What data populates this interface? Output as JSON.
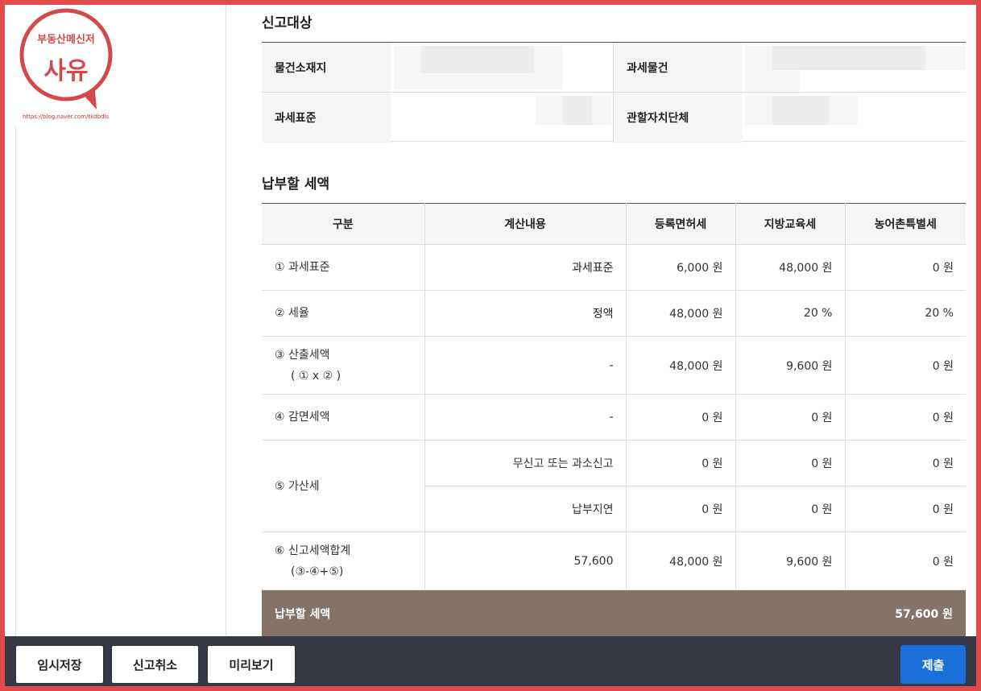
{
  "logo": {
    "top_text": "부동산메신저",
    "main_text": "사유",
    "url": "https://blog.naver.com/tkdbdls"
  },
  "target_section": {
    "title": "신고대상",
    "labels": {
      "property_location": "물건소재지",
      "taxable_object": "과세물건",
      "tax_base": "과세표준",
      "local_government": "관할자치단체"
    }
  },
  "tax_section": {
    "title": "납부할 세액",
    "headers": [
      "구분",
      "계산내용",
      "등록면허세",
      "지방교육세",
      "농어촌특별세"
    ],
    "rows": [
      {
        "label": "① 과세표준",
        "calc": "과세표준",
        "reg": "6,000 원",
        "edu": "48,000 원",
        "rural": "0 원"
      },
      {
        "label": "② 세율",
        "calc": "정액",
        "reg": "48,000 원",
        "edu": "20 %",
        "rural": "20 %"
      },
      {
        "label": "③ 산출세액",
        "label2": "( ① x ② )",
        "calc": "-",
        "reg": "48,000 원",
        "edu": "9,600 원",
        "rural": "0 원"
      },
      {
        "label": "④ 감면세액",
        "calc": "-",
        "reg": "0 원",
        "edu": "0 원",
        "rural": "0 원"
      },
      {
        "label": "⑤ 가산세",
        "calc": "무신고 또는 과소신고",
        "reg": "0 원",
        "edu": "0 원",
        "rural": "0 원"
      },
      {
        "calc": "납부지연",
        "reg": "0 원",
        "edu": "0 원",
        "rural": "0 원"
      },
      {
        "label": "⑥ 신고세액합계",
        "label2": "(③-④+⑤)",
        "calc": "57,600",
        "reg": "48,000 원",
        "edu": "9,600 원",
        "rural": "0 원"
      }
    ],
    "total_label": "납부할 세액",
    "total_value": "57,600 원"
  },
  "bottom_bar": {
    "temp_save": "임시저장",
    "cancel": "신고취소",
    "preview": "미리보기",
    "submit": "제출"
  },
  "colors": {
    "frame": "#e04a4a",
    "total_bg": "#85736a",
    "bottom_bar": "#363846",
    "submit": "#1a6fd8"
  }
}
